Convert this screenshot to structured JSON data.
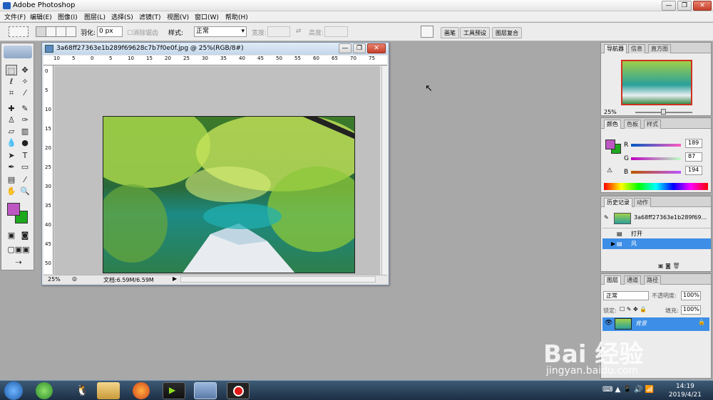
{
  "window": {
    "title": "Adobe Photoshop"
  },
  "menu": [
    "文件(F)",
    "编辑(E)",
    "图像(I)",
    "图层(L)",
    "选择(S)",
    "滤镜(T)",
    "视图(V)",
    "窗口(W)",
    "帮助(H)"
  ],
  "options": {
    "feather_label": "羽化:",
    "feather_value": "0 px",
    "antialias_label": "消除锯齿",
    "style_label": "样式:",
    "style_value": "正常",
    "width_label": "宽度:",
    "height_label": "高度:",
    "palette_wells": [
      "画笔",
      "工具预设",
      "图层复合"
    ]
  },
  "document": {
    "title": "3a68ff27363e1b289f69628c7b7f0e0f.jpg @ 25%(RGB/8#)",
    "zoom": "25%",
    "doc_info": "文档:6.59M/6.59M",
    "ruler_h": [
      "10",
      "5",
      "0",
      "5",
      "10",
      "15",
      "20",
      "25",
      "30",
      "35",
      "40",
      "45",
      "50",
      "55",
      "60",
      "65",
      "70",
      "75"
    ],
    "ruler_v": [
      "0",
      "5",
      "10",
      "15",
      "20",
      "25",
      "30",
      "35",
      "40",
      "45",
      "50"
    ]
  },
  "navigator": {
    "tabs": [
      "导航器",
      "信息",
      "直方图"
    ],
    "zoom": "25%"
  },
  "color": {
    "tabs": [
      "颜色",
      "色板",
      "样式"
    ],
    "r_label": "R",
    "r_value": "189",
    "g_label": "G",
    "g_value": "87",
    "b_label": "B",
    "b_value": "194",
    "foreground": "#bd57c2",
    "background": "#1ea81e"
  },
  "history": {
    "tabs": [
      "历史记录",
      "动作"
    ],
    "snapshot": "3a68ff27363e1b289f69...",
    "items": [
      "打开",
      "风"
    ]
  },
  "layers": {
    "tabs": [
      "图层",
      "通道",
      "路径"
    ],
    "blend_mode": "正常",
    "opacity_label": "不透明度:",
    "opacity_value": "100%",
    "lock_label": "锁定:",
    "fill_label": "填充:",
    "fill_value": "100%",
    "layer_name": "背景"
  },
  "taskbar": {
    "time": "14:19",
    "date": "2019/4/21"
  },
  "watermark": {
    "brand": "Bai 经验",
    "url": "jingyan.baidu.com"
  }
}
